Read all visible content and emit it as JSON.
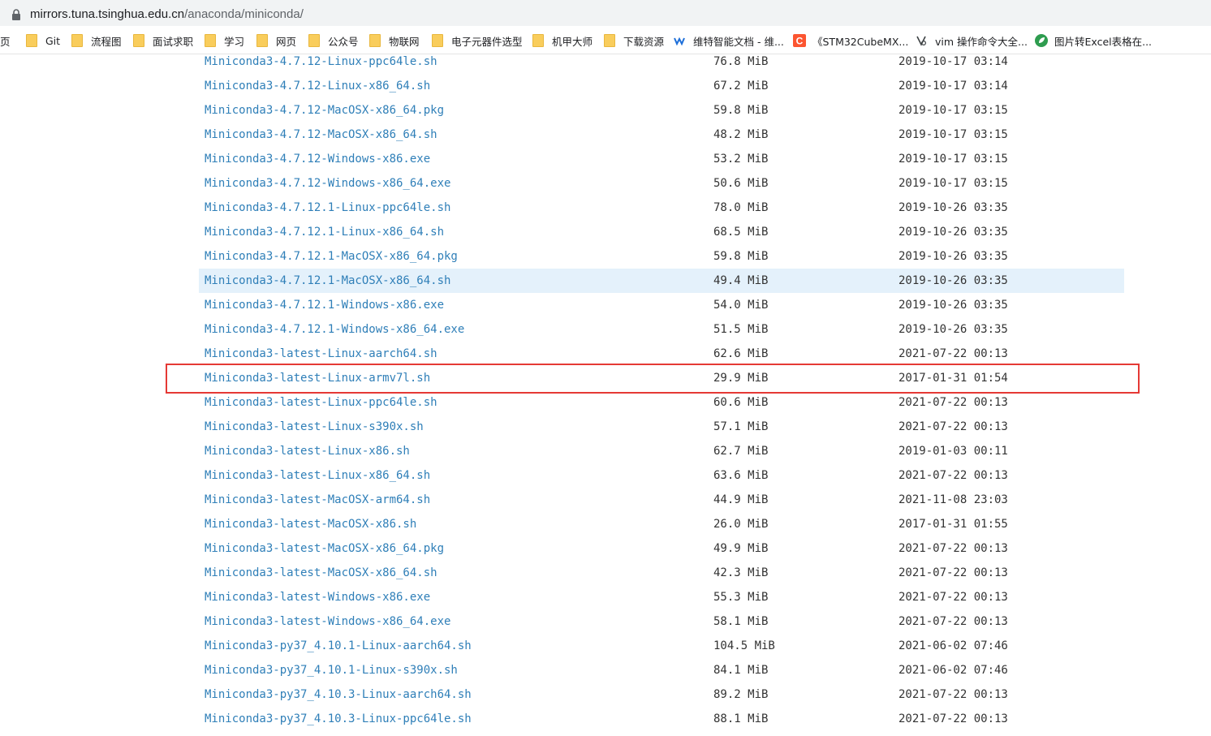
{
  "address_bar": {
    "host": "mirrors.tuna.tsinghua.edu.cn",
    "path": "/anaconda/miniconda/"
  },
  "bookmarks": [
    {
      "label": "页",
      "icon": "none"
    },
    {
      "label": "Git",
      "icon": "folder-icon"
    },
    {
      "label": "流程图",
      "icon": "folder-icon"
    },
    {
      "label": "面试求职",
      "icon": "folder-icon"
    },
    {
      "label": "学习",
      "icon": "folder-icon"
    },
    {
      "label": "网页",
      "icon": "folder-icon"
    },
    {
      "label": "公众号",
      "icon": "folder-icon"
    },
    {
      "label": "物联网",
      "icon": "folder-icon"
    },
    {
      "label": "电子元器件选型",
      "icon": "folder-icon"
    },
    {
      "label": "机甲大师",
      "icon": "folder-icon"
    },
    {
      "label": "下载资源",
      "icon": "folder-icon"
    },
    {
      "label": "维特智能文档 - 维...",
      "icon": "wit-logo-icon"
    },
    {
      "label": "《STM32CubeMX...",
      "icon": "csdn-logo-icon"
    },
    {
      "label": "vim 操作命令大全...",
      "icon": "vim-logo-icon"
    },
    {
      "label": "图片转Excel表格在...",
      "icon": "leaf-logo-icon"
    }
  ],
  "colors": {
    "link": "#2f7fb8",
    "hover_row": "#e4f1fb",
    "highlight_border": "#e53935",
    "folder": "#f9cd5c"
  },
  "files": [
    {
      "name": "Miniconda3-4.7.12-Linux-ppc64le.sh",
      "size": "76.8 MiB",
      "date": "2019-10-17 03:14"
    },
    {
      "name": "Miniconda3-4.7.12-Linux-x86_64.sh",
      "size": "67.2 MiB",
      "date": "2019-10-17 03:14"
    },
    {
      "name": "Miniconda3-4.7.12-MacOSX-x86_64.pkg",
      "size": "59.8 MiB",
      "date": "2019-10-17 03:15"
    },
    {
      "name": "Miniconda3-4.7.12-MacOSX-x86_64.sh",
      "size": "48.2 MiB",
      "date": "2019-10-17 03:15"
    },
    {
      "name": "Miniconda3-4.7.12-Windows-x86.exe",
      "size": "53.2 MiB",
      "date": "2019-10-17 03:15"
    },
    {
      "name": "Miniconda3-4.7.12-Windows-x86_64.exe",
      "size": "50.6 MiB",
      "date": "2019-10-17 03:15"
    },
    {
      "name": "Miniconda3-4.7.12.1-Linux-ppc64le.sh",
      "size": "78.0 MiB",
      "date": "2019-10-26 03:35"
    },
    {
      "name": "Miniconda3-4.7.12.1-Linux-x86_64.sh",
      "size": "68.5 MiB",
      "date": "2019-10-26 03:35"
    },
    {
      "name": "Miniconda3-4.7.12.1-MacOSX-x86_64.pkg",
      "size": "59.8 MiB",
      "date": "2019-10-26 03:35"
    },
    {
      "name": "Miniconda3-4.7.12.1-MacOSX-x86_64.sh",
      "size": "49.4 MiB",
      "date": "2019-10-26 03:35"
    },
    {
      "name": "Miniconda3-4.7.12.1-Windows-x86.exe",
      "size": "54.0 MiB",
      "date": "2019-10-26 03:35"
    },
    {
      "name": "Miniconda3-4.7.12.1-Windows-x86_64.exe",
      "size": "51.5 MiB",
      "date": "2019-10-26 03:35"
    },
    {
      "name": "Miniconda3-latest-Linux-aarch64.sh",
      "size": "62.6 MiB",
      "date": "2021-07-22 00:13"
    },
    {
      "name": "Miniconda3-latest-Linux-armv7l.sh",
      "size": "29.9 MiB",
      "date": "2017-01-31 01:54"
    },
    {
      "name": "Miniconda3-latest-Linux-ppc64le.sh",
      "size": "60.6 MiB",
      "date": "2021-07-22 00:13"
    },
    {
      "name": "Miniconda3-latest-Linux-s390x.sh",
      "size": "57.1 MiB",
      "date": "2021-07-22 00:13"
    },
    {
      "name": "Miniconda3-latest-Linux-x86.sh",
      "size": "62.7 MiB",
      "date": "2019-01-03 00:11"
    },
    {
      "name": "Miniconda3-latest-Linux-x86_64.sh",
      "size": "63.6 MiB",
      "date": "2021-07-22 00:13"
    },
    {
      "name": "Miniconda3-latest-MacOSX-arm64.sh",
      "size": "44.9 MiB",
      "date": "2021-11-08 23:03"
    },
    {
      "name": "Miniconda3-latest-MacOSX-x86.sh",
      "size": "26.0 MiB",
      "date": "2017-01-31 01:55"
    },
    {
      "name": "Miniconda3-latest-MacOSX-x86_64.pkg",
      "size": "49.9 MiB",
      "date": "2021-07-22 00:13"
    },
    {
      "name": "Miniconda3-latest-MacOSX-x86_64.sh",
      "size": "42.3 MiB",
      "date": "2021-07-22 00:13"
    },
    {
      "name": "Miniconda3-latest-Windows-x86.exe",
      "size": "55.3 MiB",
      "date": "2021-07-22 00:13"
    },
    {
      "name": "Miniconda3-latest-Windows-x86_64.exe",
      "size": "58.1 MiB",
      "date": "2021-07-22 00:13"
    },
    {
      "name": "Miniconda3-py37_4.10.1-Linux-aarch64.sh",
      "size": "104.5 MiB",
      "date": "2021-06-02 07:46"
    },
    {
      "name": "Miniconda3-py37_4.10.1-Linux-s390x.sh",
      "size": "84.1 MiB",
      "date": "2021-06-02 07:46"
    },
    {
      "name": "Miniconda3-py37_4.10.3-Linux-aarch64.sh",
      "size": "89.2 MiB",
      "date": "2021-07-22 00:13"
    },
    {
      "name": "Miniconda3-py37_4.10.3-Linux-ppc64le.sh",
      "size": "88.1 MiB",
      "date": "2021-07-22 00:13"
    }
  ],
  "hovered_file": "Miniconda3-4.7.12.1-MacOSX-x86_64.sh",
  "highlighted_file": "Miniconda3-latest-Linux-armv7l.sh"
}
